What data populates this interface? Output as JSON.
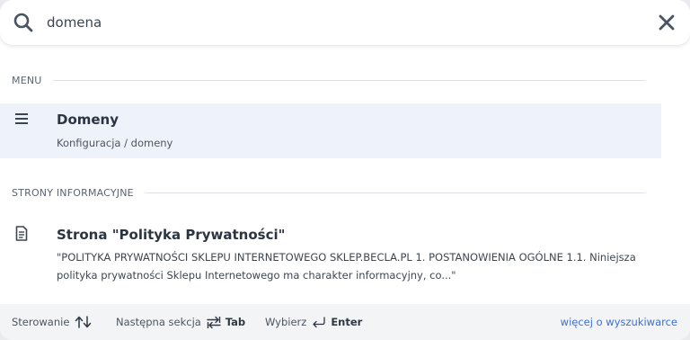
{
  "search": {
    "value": "domena",
    "icon": "search-icon",
    "close_icon": "close-icon"
  },
  "sections": {
    "menu": {
      "label": "MENU",
      "results": [
        {
          "icon": "menu-icon",
          "title": "Domeny",
          "subtitle": "Konfiguracja / domeny"
        }
      ]
    },
    "info_pages": {
      "label": "STRONY INFORMACYJNE",
      "results": [
        {
          "icon": "document-icon",
          "title": "Strona \"Polityka Prywatności\"",
          "description": "\"POLITYKA PRYWATNOŚCI SKLEPU INTERNETOWEGO SKLEP.BECLA.PL 1.    POSTANOWIENIA OGÓLNE 1.1. Niniejsza polityka prywatności Sklepu Internetowego ma charakter informacyjny, co...\""
        }
      ]
    }
  },
  "footer": {
    "navigate_label": "Sterowanie",
    "navigate_icon": "up-down-arrows-icon",
    "next_section_label": "Następna sekcja",
    "next_section_icon": "swap-arrows-icon",
    "next_section_key": "Tab",
    "select_label": "Wybierz",
    "select_icon": "enter-icon",
    "select_key": "Enter",
    "more_link": "więcej o wyszukiwarce"
  },
  "colors": {
    "active_row": "#edf2fb",
    "link": "#3c6fd8",
    "footer_bg": "#f3f4f6"
  }
}
